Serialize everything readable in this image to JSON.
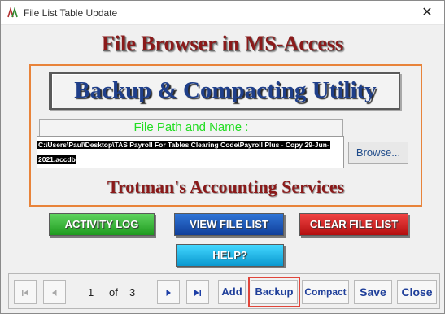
{
  "window": {
    "title": "File List Table Update",
    "close_label": "✕",
    "app_icon": "access-app-icon"
  },
  "header": {
    "title": "File Browser in MS-Access"
  },
  "panel": {
    "utility_title": "Backup & Compacting Utility",
    "path_label": "File Path and Name :",
    "path_value": "C:\\Users\\Paul\\Desktop\\TAS Payroll For Tables Clearing Code\\Payroll Plus - Copy 29-Jun-2021.accdb",
    "browse_label": "Browse...",
    "company": "Trotman's Accounting Services"
  },
  "actions": {
    "activity_log": "ACTIVITY LOG",
    "view_file_list": "VIEW FILE LIST",
    "clear_file_list": "CLEAR FILE LIST",
    "help": "HELP?"
  },
  "navigation": {
    "first_icon": "first-record-icon",
    "prev_icon": "previous-record-icon",
    "next_icon": "next-record-icon",
    "last_icon": "last-record-icon",
    "current": "1",
    "of_label": "of",
    "total": "3"
  },
  "commands": {
    "add": "Add",
    "backup": "Backup",
    "compact": "Compact",
    "save": "Save",
    "close": "Close"
  },
  "colors": {
    "title_red": "#8b1a1a",
    "utility_blue": "#1f3f8a",
    "panel_border": "#e8833a",
    "path_label_green": "#22dd22",
    "command_blue": "#1f3f9a",
    "highlight_red": "#e0453a"
  }
}
